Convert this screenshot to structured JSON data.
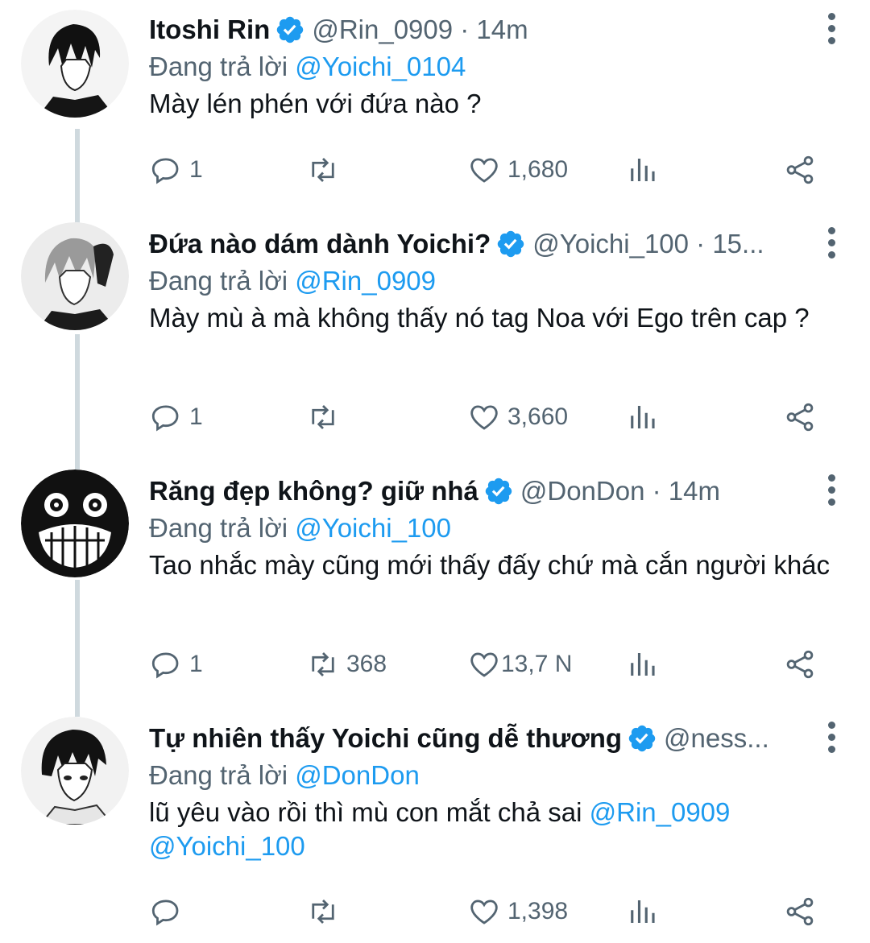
{
  "colors": {
    "accent": "#1d9bf0",
    "muted": "#536471",
    "text": "#0f1419",
    "thread_line": "#cfd9de"
  },
  "tweets": [
    {
      "name": "Itoshi Rin",
      "meta": "@Rin_0909 · 14m",
      "reply_prefix": "Đang trả lời ",
      "reply_to": "@Yoichi_0104",
      "text": "Mày lén phén với đứa nào ?",
      "text_mentions": "",
      "replies": "1",
      "retweets": "",
      "likes": "1,680"
    },
    {
      "name": "Đứa nào dám dành Yoichi?",
      "meta": "@Yoichi_100 · 15...",
      "reply_prefix": "Đang trả lời ",
      "reply_to": "@Rin_0909",
      "text": "Mày mù à mà không thấy nó tag Noa với Ego trên cap ?",
      "text_mentions": "",
      "replies": "1",
      "retweets": "",
      "likes": "3,660"
    },
    {
      "name": "Răng đẹp không? giữ nhá",
      "meta": "@DonDon · 14m",
      "reply_prefix": "Đang trả lời ",
      "reply_to": "@Yoichi_100",
      "text": "Tao nhắc mày cũng mới thấy đấy chứ mà cắn người khác",
      "text_mentions": "",
      "replies": "1",
      "retweets": "368",
      "likes": "13,7 N"
    },
    {
      "name": "Tự nhiên thấy Yoichi cũng dễ thương",
      "meta": "@ness...",
      "reply_prefix": "Đang trả lời ",
      "reply_to": "@DonDon",
      "text": "lũ yêu vào rồi thì mù con mắt chả sai ",
      "text_mentions": "@Rin_0909 @Yoichi_100",
      "replies": "",
      "retweets": "",
      "likes": "1,398"
    }
  ],
  "icons": {
    "verified": "verified-badge-icon",
    "more": "more-vertical-icon",
    "reply": "reply-bubble-icon",
    "retweet": "retweet-icon",
    "like": "heart-icon",
    "views": "views-bar-chart-icon",
    "share": "share-icon"
  }
}
